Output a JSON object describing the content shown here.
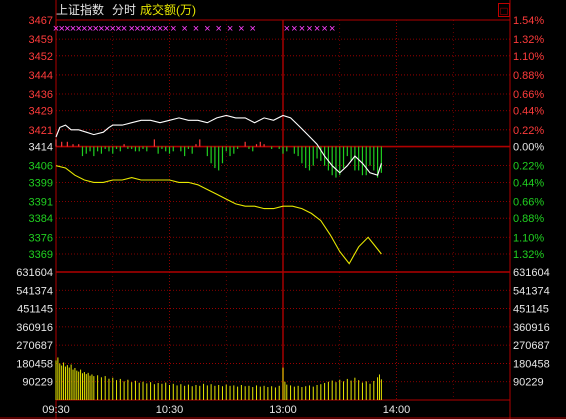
{
  "header": {
    "index_name": "上证指数",
    "view_mode": "分时",
    "volume_label": "成交额(万)",
    "corner_box": "□"
  },
  "colors": {
    "background": "#000000",
    "grid": "#b00000",
    "price_line": "#ffffff",
    "avg_line": "#e8e800",
    "up": "#ff3b3b",
    "down": "#20d020",
    "neutral": "#e6e6e6",
    "volume": "#e8e800",
    "marker": "#ff40ff"
  },
  "chart_data": [
    {
      "type": "line",
      "title": "上证指数 分时",
      "y_left_ticks": [
        {
          "label": "3467",
          "value": 3467,
          "dir": "up"
        },
        {
          "label": "3459",
          "value": 3459,
          "dir": "up"
        },
        {
          "label": "3452",
          "value": 3452,
          "dir": "up"
        },
        {
          "label": "3444",
          "value": 3444,
          "dir": "up"
        },
        {
          "label": "3436",
          "value": 3436,
          "dir": "up"
        },
        {
          "label": "3429",
          "value": 3429,
          "dir": "up"
        },
        {
          "label": "3421",
          "value": 3421,
          "dir": "up"
        },
        {
          "label": "3414",
          "value": 3414,
          "dir": "flat"
        },
        {
          "label": "3406",
          "value": 3406,
          "dir": "down"
        },
        {
          "label": "3399",
          "value": 3399,
          "dir": "down"
        },
        {
          "label": "3391",
          "value": 3391,
          "dir": "down"
        },
        {
          "label": "3384",
          "value": 3384,
          "dir": "down"
        },
        {
          "label": "3376",
          "value": 3376,
          "dir": "down"
        },
        {
          "label": "3369",
          "value": 3369,
          "dir": "down"
        }
      ],
      "y_right_ticks": [
        {
          "label": "1.54%",
          "value": 3467,
          "dir": "up"
        },
        {
          "label": "1.32%",
          "value": 3459,
          "dir": "up"
        },
        {
          "label": "1.10%",
          "value": 3452,
          "dir": "up"
        },
        {
          "label": "0.88%",
          "value": 3444,
          "dir": "up"
        },
        {
          "label": "0.66%",
          "value": 3436,
          "dir": "up"
        },
        {
          "label": "0.44%",
          "value": 3429,
          "dir": "up"
        },
        {
          "label": "0.22%",
          "value": 3421,
          "dir": "up"
        },
        {
          "label": "0.00%",
          "value": 3414,
          "dir": "flat"
        },
        {
          "label": "0.22%",
          "value": 3406,
          "dir": "down"
        },
        {
          "label": "0.44%",
          "value": 3399,
          "dir": "down"
        },
        {
          "label": "0.66%",
          "value": 3391,
          "dir": "down"
        },
        {
          "label": "0.88%",
          "value": 3384,
          "dir": "down"
        },
        {
          "label": "1.10%",
          "value": 3376,
          "dir": "down"
        },
        {
          "label": "1.32%",
          "value": 3369,
          "dir": "down"
        }
      ],
      "ylim": [
        3365,
        3467
      ],
      "prev_close": 3414,
      "x_range_minutes": [
        0,
        240
      ],
      "x_ticks": [
        {
          "label": "09:30",
          "minute": 0
        },
        {
          "label": "10:30",
          "minute": 60
        },
        {
          "label": "13:00",
          "minute": 120
        },
        {
          "label": "14:00",
          "minute": 180
        }
      ],
      "price_series": [
        [
          0,
          3418
        ],
        [
          2,
          3422
        ],
        [
          5,
          3423
        ],
        [
          8,
          3421
        ],
        [
          12,
          3421
        ],
        [
          16,
          3420
        ],
        [
          20,
          3419
        ],
        [
          25,
          3420
        ],
        [
          28,
          3422
        ],
        [
          30,
          3423
        ],
        [
          35,
          3423
        ],
        [
          40,
          3424
        ],
        [
          45,
          3425
        ],
        [
          50,
          3425
        ],
        [
          55,
          3424
        ],
        [
          60,
          3425
        ],
        [
          65,
          3426
        ],
        [
          70,
          3425
        ],
        [
          75,
          3425
        ],
        [
          80,
          3424
        ],
        [
          85,
          3426
        ],
        [
          90,
          3427
        ],
        [
          95,
          3426
        ],
        [
          100,
          3426
        ],
        [
          105,
          3424
        ],
        [
          110,
          3426
        ],
        [
          115,
          3425
        ],
        [
          120,
          3427
        ],
        [
          124,
          3426
        ],
        [
          128,
          3423
        ],
        [
          133,
          3419
        ],
        [
          138,
          3415
        ],
        [
          142,
          3410
        ],
        [
          146,
          3406
        ],
        [
          150,
          3403
        ],
        [
          154,
          3406
        ],
        [
          158,
          3410
        ],
        [
          162,
          3407
        ],
        [
          166,
          3403
        ],
        [
          170,
          3402
        ],
        [
          172,
          3407
        ]
      ],
      "avg_series": [
        [
          0,
          3406
        ],
        [
          5,
          3405
        ],
        [
          10,
          3402
        ],
        [
          15,
          3400
        ],
        [
          20,
          3399
        ],
        [
          25,
          3399
        ],
        [
          30,
          3400
        ],
        [
          35,
          3400
        ],
        [
          40,
          3401
        ],
        [
          45,
          3400
        ],
        [
          50,
          3400
        ],
        [
          55,
          3400
        ],
        [
          60,
          3400
        ],
        [
          65,
          3399
        ],
        [
          70,
          3399
        ],
        [
          75,
          3398
        ],
        [
          80,
          3396
        ],
        [
          85,
          3394
        ],
        [
          90,
          3392
        ],
        [
          95,
          3390
        ],
        [
          100,
          3389
        ],
        [
          105,
          3389
        ],
        [
          110,
          3388
        ],
        [
          115,
          3388
        ],
        [
          120,
          3389
        ],
        [
          125,
          3389
        ],
        [
          130,
          3388
        ],
        [
          135,
          3386
        ],
        [
          140,
          3383
        ],
        [
          145,
          3377
        ],
        [
          150,
          3370
        ],
        [
          155,
          3365
        ],
        [
          160,
          3372
        ],
        [
          165,
          3376
        ],
        [
          168,
          3373
        ],
        [
          172,
          3369
        ]
      ],
      "breadth_bars": [
        [
          0,
          3417
        ],
        [
          3,
          3416
        ],
        [
          6,
          3416
        ],
        [
          9,
          3415
        ],
        [
          12,
          3415
        ],
        [
          14,
          3410
        ],
        [
          16,
          3411
        ],
        [
          18,
          3412
        ],
        [
          20,
          3410
        ],
        [
          22,
          3412
        ],
        [
          24,
          3411
        ],
        [
          26,
          3413
        ],
        [
          28,
          3412
        ],
        [
          30,
          3411
        ],
        [
          32,
          3413
        ],
        [
          34,
          3412
        ],
        [
          36,
          3415
        ],
        [
          38,
          3413
        ],
        [
          40,
          3413
        ],
        [
          42,
          3412
        ],
        [
          44,
          3412
        ],
        [
          46,
          3413
        ],
        [
          48,
          3412
        ],
        [
          50,
          3414
        ],
        [
          52,
          3417
        ],
        [
          54,
          3411
        ],
        [
          56,
          3413
        ],
        [
          58,
          3412
        ],
        [
          60,
          3411
        ],
        [
          62,
          3412
        ],
        [
          64,
          3414
        ],
        [
          66,
          3412
        ],
        [
          68,
          3410
        ],
        [
          70,
          3413
        ],
        [
          72,
          3411
        ],
        [
          74,
          3415
        ],
        [
          76,
          3417
        ],
        [
          78,
          3414
        ],
        [
          80,
          3410
        ],
        [
          82,
          3407
        ],
        [
          84,
          3405
        ],
        [
          86,
          3404
        ],
        [
          88,
          3407
        ],
        [
          90,
          3412
        ],
        [
          92,
          3410
        ],
        [
          94,
          3411
        ],
        [
          96,
          3413
        ],
        [
          98,
          3414
        ],
        [
          100,
          3416
        ],
        [
          102,
          3413
        ],
        [
          104,
          3412
        ],
        [
          106,
          3415
        ],
        [
          108,
          3416
        ],
        [
          110,
          3415
        ],
        [
          112,
          3414
        ],
        [
          114,
          3413
        ],
        [
          116,
          3414
        ],
        [
          118,
          3413
        ],
        [
          120,
          3411
        ],
        [
          122,
          3412
        ],
        [
          124,
          3414
        ],
        [
          126,
          3411
        ],
        [
          128,
          3410
        ],
        [
          130,
          3407
        ],
        [
          132,
          3405
        ],
        [
          134,
          3404
        ],
        [
          136,
          3406
        ],
        [
          138,
          3409
        ],
        [
          140,
          3408
        ],
        [
          142,
          3406
        ],
        [
          144,
          3404
        ],
        [
          146,
          3402
        ],
        [
          148,
          3401
        ],
        [
          150,
          3402
        ],
        [
          152,
          3405
        ],
        [
          154,
          3410
        ],
        [
          156,
          3408
        ],
        [
          158,
          3404
        ],
        [
          160,
          3404
        ],
        [
          162,
          3402
        ],
        [
          164,
          3402
        ],
        [
          166,
          3406
        ],
        [
          168,
          3404
        ],
        [
          170,
          3401
        ],
        [
          172,
          3403
        ]
      ],
      "signal_markers": {
        "symbol": "×",
        "minutes": [
          0,
          3,
          6,
          9,
          12,
          15,
          18,
          21,
          24,
          27,
          30,
          33,
          36,
          40,
          43,
          46,
          49,
          52,
          55,
          58,
          62,
          68,
          74,
          80,
          86,
          92,
          98,
          104,
          122,
          126,
          130,
          134,
          138,
          142,
          146
        ]
      }
    },
    {
      "type": "bar",
      "title": "成交额(万)",
      "y_ticks": [
        {
          "label": "631604",
          "value": 631604
        },
        {
          "label": "541374",
          "value": 541374
        },
        {
          "label": "451145",
          "value": 451145
        },
        {
          "label": "360916",
          "value": 360916
        },
        {
          "label": "270687",
          "value": 270687
        },
        {
          "label": "180458",
          "value": 180458
        },
        {
          "label": "90229",
          "value": 90229
        }
      ],
      "ylim": [
        0,
        631604
      ],
      "x_range_minutes": [
        0,
        240
      ],
      "volume_series": [
        [
          0,
          195000
        ],
        [
          1,
          210000
        ],
        [
          2,
          180000
        ],
        [
          3,
          170000
        ],
        [
          4,
          185000
        ],
        [
          5,
          165000
        ],
        [
          6,
          172000
        ],
        [
          7,
          160000
        ],
        [
          8,
          175000
        ],
        [
          9,
          150000
        ],
        [
          10,
          158000
        ],
        [
          11,
          145000
        ],
        [
          12,
          140000
        ],
        [
          13,
          150000
        ],
        [
          14,
          132000
        ],
        [
          15,
          138000
        ],
        [
          16,
          128000
        ],
        [
          17,
          134000
        ],
        [
          18,
          120000
        ],
        [
          19,
          126000
        ],
        [
          20,
          118000
        ],
        [
          22,
          122000
        ],
        [
          24,
          112000
        ],
        [
          26,
          118000
        ],
        [
          28,
          105000
        ],
        [
          30,
          110000
        ],
        [
          32,
          98000
        ],
        [
          34,
          104000
        ],
        [
          36,
          92000
        ],
        [
          38,
          100000
        ],
        [
          40,
          88000
        ],
        [
          42,
          95000
        ],
        [
          44,
          85000
        ],
        [
          46,
          90000
        ],
        [
          48,
          82000
        ],
        [
          50,
          88000
        ],
        [
          52,
          78000
        ],
        [
          54,
          84000
        ],
        [
          56,
          80000
        ],
        [
          58,
          86000
        ],
        [
          60,
          74000
        ],
        [
          62,
          80000
        ],
        [
          64,
          72000
        ],
        [
          66,
          78000
        ],
        [
          68,
          70000
        ],
        [
          70,
          76000
        ],
        [
          72,
          68000
        ],
        [
          74,
          74000
        ],
        [
          76,
          70000
        ],
        [
          78,
          80000
        ],
        [
          80,
          72000
        ],
        [
          82,
          78000
        ],
        [
          84,
          70000
        ],
        [
          86,
          74000
        ],
        [
          88,
          68000
        ],
        [
          90,
          76000
        ],
        [
          92,
          70000
        ],
        [
          94,
          72000
        ],
        [
          96,
          66000
        ],
        [
          98,
          74000
        ],
        [
          100,
          68000
        ],
        [
          102,
          70000
        ],
        [
          104,
          64000
        ],
        [
          106,
          72000
        ],
        [
          108,
          66000
        ],
        [
          110,
          70000
        ],
        [
          112,
          64000
        ],
        [
          114,
          68000
        ],
        [
          116,
          62000
        ],
        [
          118,
          70000
        ],
        [
          120,
          160000
        ],
        [
          121,
          90000
        ],
        [
          122,
          76000
        ],
        [
          124,
          72000
        ],
        [
          126,
          66000
        ],
        [
          128,
          70000
        ],
        [
          130,
          64000
        ],
        [
          132,
          68000
        ],
        [
          134,
          72000
        ],
        [
          136,
          66000
        ],
        [
          138,
          74000
        ],
        [
          140,
          78000
        ],
        [
          142,
          84000
        ],
        [
          144,
          90000
        ],
        [
          146,
          96000
        ],
        [
          148,
          88000
        ],
        [
          150,
          100000
        ],
        [
          152,
          92000
        ],
        [
          154,
          104000
        ],
        [
          156,
          96000
        ],
        [
          158,
          110000
        ],
        [
          160,
          98000
        ],
        [
          162,
          86000
        ],
        [
          164,
          92000
        ],
        [
          166,
          80000
        ],
        [
          168,
          94000
        ],
        [
          170,
          112000
        ],
        [
          171,
          126000
        ],
        [
          172,
          102000
        ]
      ]
    }
  ]
}
